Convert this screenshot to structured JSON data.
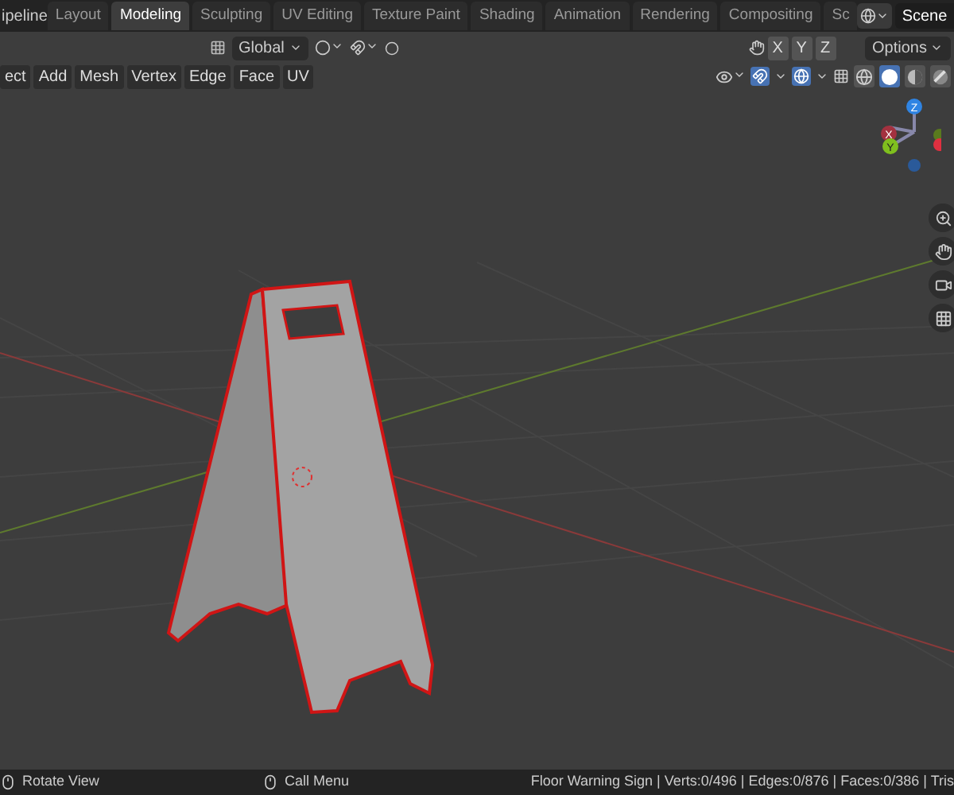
{
  "workspace_label": "ipeline",
  "tabs": [
    {
      "label": "Layout",
      "selected": false
    },
    {
      "label": "Modeling",
      "selected": true
    },
    {
      "label": "Sculpting",
      "selected": false
    },
    {
      "label": "UV Editing",
      "selected": false
    },
    {
      "label": "Texture Paint",
      "selected": false
    },
    {
      "label": "Shading",
      "selected": false
    },
    {
      "label": "Animation",
      "selected": false
    },
    {
      "label": "Rendering",
      "selected": false
    },
    {
      "label": "Compositing",
      "selected": false
    },
    {
      "label": "Sc",
      "selected": false
    }
  ],
  "scene": {
    "value": "Scene"
  },
  "transform_orientation": {
    "value": "Global"
  },
  "mirror_axes": [
    {
      "label": "X",
      "on": false
    },
    {
      "label": "Y",
      "on": false
    },
    {
      "label": "Z",
      "on": false
    }
  ],
  "options_label": "Options",
  "menus": [
    "ect",
    "Add",
    "Mesh",
    "Vertex",
    "Edge",
    "Face",
    "UV"
  ],
  "shading_modes": [
    {
      "kind": "wireframe",
      "selected": false
    },
    {
      "kind": "solid",
      "selected": true
    },
    {
      "kind": "material",
      "selected": false
    },
    {
      "kind": "rendered",
      "selected": false
    }
  ],
  "gizmo_axes": [
    "X",
    "Y",
    "Z"
  ],
  "status_bar": {
    "hints": [
      "Rotate View",
      "Call Menu"
    ],
    "stats": "Floor Warning Sign | Verts:0/496 | Edges:0/876 | Faces:0/386 | Tris"
  }
}
